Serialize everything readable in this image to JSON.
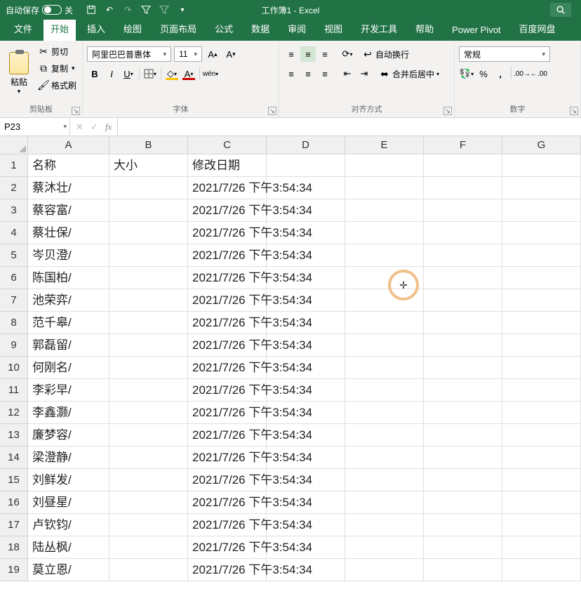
{
  "titlebar": {
    "autosave_label": "自动保存",
    "autosave_state": "关",
    "app_title": "工作簿1  -  Excel"
  },
  "tabs": {
    "items": [
      "文件",
      "开始",
      "插入",
      "绘图",
      "页面布局",
      "公式",
      "数据",
      "审阅",
      "视图",
      "开发工具",
      "帮助",
      "Power Pivot",
      "百度网盘"
    ],
    "active_index": 1
  },
  "ribbon": {
    "clipboard": {
      "paste": "粘贴",
      "cut": "剪切",
      "copy": "复制",
      "format": "格式刷",
      "group_label": "剪贴板"
    },
    "font": {
      "name": "阿里巴巴普惠体",
      "size": "11",
      "group_label": "字体"
    },
    "align": {
      "wrap": "自动换行",
      "merge": "合并后居中",
      "group_label": "对齐方式"
    },
    "number": {
      "format": "常规",
      "group_label": "数字"
    }
  },
  "namebox": "P23",
  "formula": "",
  "columns": [
    "A",
    "B",
    "C",
    "D",
    "E",
    "F",
    "G"
  ],
  "headers": {
    "name": "名称",
    "size": "大小",
    "date": "修改日期"
  },
  "rows": [
    {
      "n": 1,
      "a": "名称",
      "b": "大小",
      "c": "修改日期",
      "d": ""
    },
    {
      "n": 2,
      "a": "蔡沐壮/",
      "b": "",
      "c": "2021/7/26 下午3:54:34",
      "d": ""
    },
    {
      "n": 3,
      "a": "蔡容富/",
      "b": "",
      "c": "2021/7/26 下午3:54:34",
      "d": ""
    },
    {
      "n": 4,
      "a": "蔡壮保/",
      "b": "",
      "c": "2021/7/26 下午3:54:34",
      "d": ""
    },
    {
      "n": 5,
      "a": "岑贝澄/",
      "b": "",
      "c": "2021/7/26 下午3:54:34",
      "d": ""
    },
    {
      "n": 6,
      "a": "陈国柏/",
      "b": "",
      "c": "2021/7/26 下午3:54:34",
      "d": ""
    },
    {
      "n": 7,
      "a": "池荣弈/",
      "b": "",
      "c": "2021/7/26 下午3:54:34",
      "d": ""
    },
    {
      "n": 8,
      "a": "范千皋/",
      "b": "",
      "c": "2021/7/26 下午3:54:34",
      "d": ""
    },
    {
      "n": 9,
      "a": "郭磊留/",
      "b": "",
      "c": "2021/7/26 下午3:54:34",
      "d": ""
    },
    {
      "n": 10,
      "a": "何刚名/",
      "b": "",
      "c": "2021/7/26 下午3:54:34",
      "d": ""
    },
    {
      "n": 11,
      "a": "李彩早/",
      "b": "",
      "c": "2021/7/26 下午3:54:34",
      "d": ""
    },
    {
      "n": 12,
      "a": "李鑫灏/",
      "b": "",
      "c": "2021/7/26 下午3:54:34",
      "d": ""
    },
    {
      "n": 13,
      "a": "廉梦容/",
      "b": "",
      "c": "2021/7/26 下午3:54:34",
      "d": ""
    },
    {
      "n": 14,
      "a": "梁澄静/",
      "b": "",
      "c": "2021/7/26 下午3:54:34",
      "d": ""
    },
    {
      "n": 15,
      "a": "刘鲜发/",
      "b": "",
      "c": "2021/7/26 下午3:54:34",
      "d": ""
    },
    {
      "n": 16,
      "a": "刘昼星/",
      "b": "",
      "c": "2021/7/26 下午3:54:34",
      "d": ""
    },
    {
      "n": 17,
      "a": "卢钦钧/",
      "b": "",
      "c": "2021/7/26 下午3:54:34",
      "d": ""
    },
    {
      "n": 18,
      "a": "陆丛枫/",
      "b": "",
      "c": "2021/7/26 下午3:54:34",
      "d": ""
    },
    {
      "n": 19,
      "a": "莫立恩/",
      "b": "",
      "c": "2021/7/26 下午3:54:34",
      "d": ""
    }
  ]
}
